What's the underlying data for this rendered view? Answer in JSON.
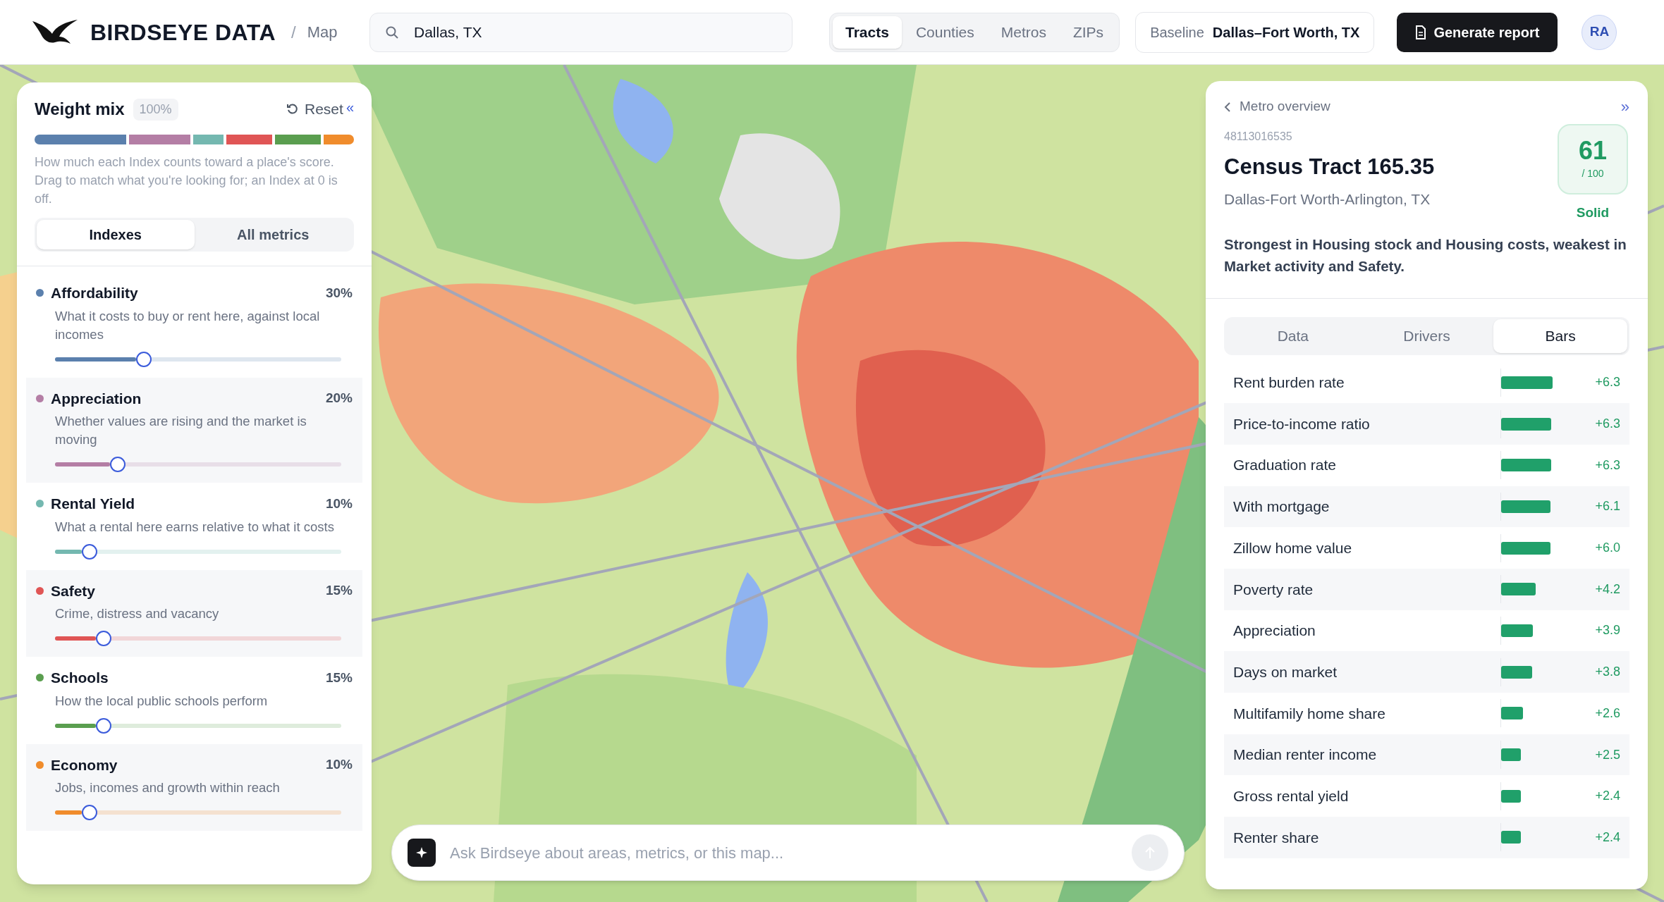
{
  "header": {
    "brand": "BIRDSEYE DATA",
    "separator": "/",
    "page": "Map",
    "search": {
      "value": "Dallas, TX"
    },
    "geo_tabs": [
      {
        "label": "Tracts",
        "selected": true
      },
      {
        "label": "Counties",
        "selected": false
      },
      {
        "label": "Metros",
        "selected": false
      },
      {
        "label": "ZIPs",
        "selected": false
      }
    ],
    "baseline": {
      "label": "Baseline",
      "value": "Dallas–Fort Worth, TX"
    },
    "report_button": "Generate report",
    "avatar": "RA"
  },
  "weight_panel": {
    "title": "Weight mix",
    "total": "100%",
    "reset": "Reset",
    "collapse": "«",
    "description": "How much each Index counts toward a place's score. Drag to match what you're looking for; an Index at 0 is off.",
    "tabs": [
      {
        "label": "Indexes",
        "selected": true
      },
      {
        "label": "All metrics",
        "selected": false
      }
    ],
    "indexes": [
      {
        "name": "Affordability",
        "weight": "30%",
        "description": "What it costs to buy or rent here, against local incomes",
        "color": "#5b80ad",
        "level": 0.31
      },
      {
        "name": "Appreciation",
        "weight": "20%",
        "description": "Whether values are rising and the market is moving",
        "color": "#b47ea5",
        "level": 0.22
      },
      {
        "name": "Rental Yield",
        "weight": "10%",
        "description": "What a rental here earns relative to what it costs",
        "color": "#74b8b0",
        "level": 0.12
      },
      {
        "name": "Safety",
        "weight": "15%",
        "description": "Crime, distress and vacancy",
        "color": "#e05555",
        "level": 0.17
      },
      {
        "name": "Schools",
        "weight": "15%",
        "description": "How the local public schools perform",
        "color": "#5a9e4f",
        "level": 0.17
      },
      {
        "name": "Economy",
        "weight": "10%",
        "description": "Jobs, incomes and growth within reach",
        "color": "#f08c2c",
        "level": 0.12
      }
    ]
  },
  "detail_panel": {
    "back": "Metro overview",
    "collapse": "»",
    "geoid": "48113016535",
    "title": "Census Tract 165.35",
    "subtitle": "Dallas-Fort Worth-Arlington, TX",
    "score": {
      "value": "61",
      "scale": "/ 100",
      "grade": "Solid"
    },
    "summary": "Strongest in Housing stock and Housing costs, weakest in Market activity and Safety.",
    "tabs": [
      {
        "label": "Data",
        "selected": false
      },
      {
        "label": "Drivers",
        "selected": false
      },
      {
        "label": "Bars",
        "selected": true
      }
    ],
    "bars": [
      {
        "label": "Rent burden rate",
        "value": "+6.3",
        "level": 0.73
      },
      {
        "label": "Price-to-income ratio",
        "value": "+6.3",
        "level": 0.71
      },
      {
        "label": "Graduation rate",
        "value": "+6.3",
        "level": 0.71
      },
      {
        "label": "With mortgage",
        "value": "+6.1",
        "level": 0.7
      },
      {
        "label": "Zillow home value",
        "value": "+6.0",
        "level": 0.7
      },
      {
        "label": "Poverty rate",
        "value": "+4.2",
        "level": 0.49
      },
      {
        "label": "Appreciation",
        "value": "+3.9",
        "level": 0.45
      },
      {
        "label": "Days on market",
        "value": "+3.8",
        "level": 0.44
      },
      {
        "label": "Multifamily home share",
        "value": "+2.6",
        "level": 0.31
      },
      {
        "label": "Median renter income",
        "value": "+2.5",
        "level": 0.28
      },
      {
        "label": "Gross rental yield",
        "value": "+2.4",
        "level": 0.28
      },
      {
        "label": "Renter share",
        "value": "+2.4",
        "level": 0.28
      }
    ]
  },
  "chat": {
    "placeholder": "Ask Birdseye about areas, metrics, or this map..."
  }
}
